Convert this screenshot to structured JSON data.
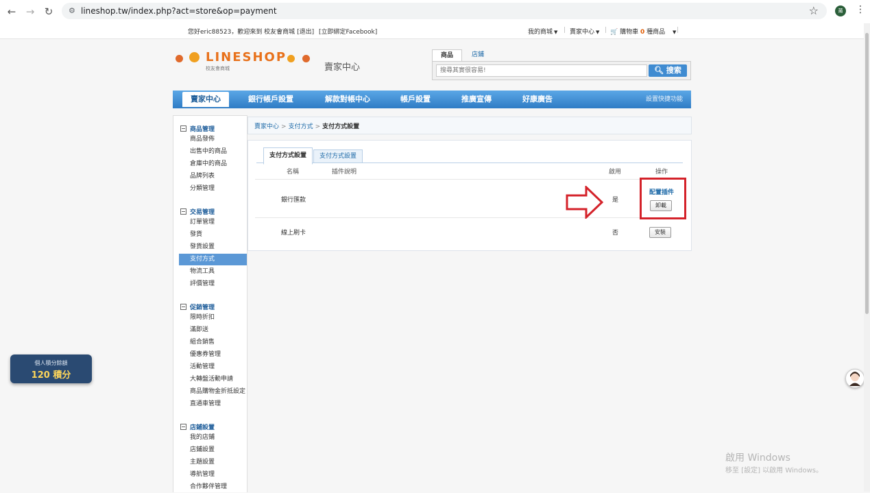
{
  "browser": {
    "url": "lineshop.tw/index.php?act=store&op=payment",
    "profile_initial": "莆"
  },
  "topbar": {
    "greeting": "您好eric88523，歡迎來到 校友會商城",
    "logout": "[退出]",
    "bind_facebook": "[立即綁定Facebook]",
    "my_store": "我的商城",
    "seller_center": "賣家中心",
    "cart_prefix": "購物車",
    "cart_count": "0",
    "cart_suffix": "種商品"
  },
  "header": {
    "logo_text": "LINESHOP",
    "logo_sub": "校友會商城",
    "section_title": "賣家中心",
    "search_tabs": [
      "商品",
      "店鋪"
    ],
    "search_placeholder": "搜尋其實很容易!",
    "search_button": "搜索"
  },
  "mainnav": {
    "items": [
      "賣家中心",
      "銀行帳戶設置",
      "解款對帳中心",
      "帳戶設置",
      "推廣宣傳",
      "好康廣告"
    ],
    "shortcut": "設置快捷功能"
  },
  "sidebar": {
    "groups": [
      {
        "title": "商品管理",
        "items": [
          "商品發佈",
          "出售中的商品",
          "倉庫中的商品",
          "品牌列表",
          "分類管理"
        ]
      },
      {
        "title": "交易管理",
        "items": [
          "訂單管理",
          "發貨",
          "發貨設置",
          "支付方式",
          "物流工具",
          "評價管理"
        ]
      },
      {
        "title": "促銷管理",
        "items": [
          "限時折扣",
          "滿即送",
          "組合銷售",
          "優惠券管理",
          "活動管理",
          "大轉盤活動申請",
          "商品購物金折抵設定",
          "直通車管理"
        ]
      },
      {
        "title": "店鋪設置",
        "items": [
          "我的店鋪",
          "店鋪設置",
          "主題設置",
          "導航管理",
          "合作夥伴管理"
        ]
      }
    ]
  },
  "breadcrumb": [
    "賣家中心",
    "支付方式",
    "支付方式設置"
  ],
  "panel": {
    "tabs": [
      "支付方式設置",
      "支付方式設置"
    ],
    "columns": [
      "名稱",
      "插件說明",
      "啟用",
      "操作"
    ],
    "rows": [
      {
        "name": "銀行匯款",
        "enabled": "是",
        "link": "配置插件",
        "button": "卸載"
      },
      {
        "name": "線上刷卡",
        "enabled": "否",
        "button": "安裝"
      }
    ]
  },
  "points": {
    "label": "個人積分餘額",
    "value": "120 積分"
  },
  "watermark": {
    "title": "啟用 Windows",
    "subtitle": "移至 [設定] 以啟用 Windows。"
  },
  "colors": {
    "accent": "#3f8bd1",
    "nav_blue": "#2f7cc5",
    "highlight": "#d4222a"
  }
}
